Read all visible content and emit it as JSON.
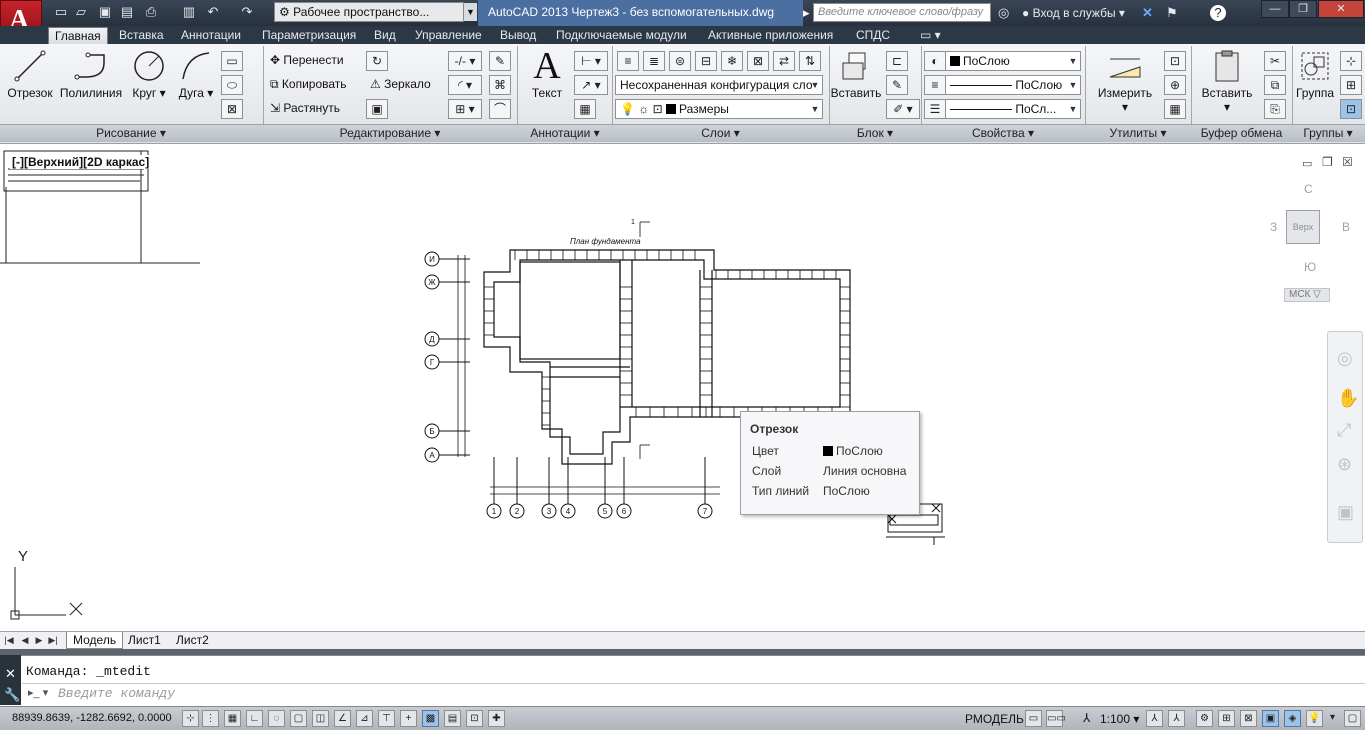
{
  "titlebar": {
    "workspace": "Рабочее пространство...",
    "app_title": "AutoCAD 2013   Чертеж3 - без вспомогательных.dwg",
    "search_placeholder": "Введите ключевое слово/фразу",
    "login": "Вход в службы"
  },
  "tabs": [
    "Главная",
    "Вставка",
    "Аннотации",
    "Параметризация",
    "Вид",
    "Управление",
    "Вывод",
    "Подключаемые модули",
    "Активные приложения",
    "СПДС"
  ],
  "ribbon": {
    "draw": {
      "line": "Отрезок",
      "polyline": "Полилиния",
      "circle": "Круг",
      "arc": "Дуга",
      "title": "Рисование"
    },
    "modify": {
      "move": "Перенести",
      "copy": "Копировать",
      "stretch": "Растянуть",
      "mirror": "Зеркало",
      "title": "Редактирование"
    },
    "annotation": {
      "text": "Текст",
      "title": "Аннотации"
    },
    "layers": {
      "layer_state": "Несохраненная конфигурация сло",
      "current_layer": "Размеры",
      "title": "Слои"
    },
    "block": {
      "insert": "Вставить",
      "title": "Блок"
    },
    "properties": {
      "color": "ПоСлою",
      "lineweight": "ПоСлою",
      "linetype": "ПоСл...",
      "title": "Свойства"
    },
    "utilities": {
      "measure": "Измерить",
      "title": "Утилиты"
    },
    "clipboard": {
      "paste": "Вставить",
      "title": "Буфер обмена"
    },
    "groups": {
      "group": "Группа",
      "title": "Группы"
    }
  },
  "viewport": {
    "label": "[-][Верхний][2D каркас]",
    "viewcube": {
      "north": "С",
      "south": "Ю",
      "west": "З",
      "east": "В",
      "face": "Верх",
      "ucs": "МСК"
    }
  },
  "drawing": {
    "axis_labels_left": [
      "И",
      "Ж",
      "Д",
      "Г",
      "Б",
      "А"
    ],
    "axis_labels_bottom": [
      "1",
      "2",
      "3",
      "4",
      "5",
      "6",
      "7"
    ],
    "plan_title": "План фундамента",
    "section_mark": "1"
  },
  "tooltip": {
    "title": "Отрезок",
    "rows": [
      {
        "key": "Цвет",
        "value": "ПоСлою"
      },
      {
        "key": "Слой",
        "value": "Линия основна"
      },
      {
        "key": "Тип линий",
        "value": "ПоСлою"
      }
    ]
  },
  "ucs_icon": {
    "x": "X",
    "y": "Y"
  },
  "layout_tabs": [
    "Модель",
    "Лист1",
    "Лист2"
  ],
  "command": {
    "history": "Команда:  _mtedit",
    "placeholder": "Введите команду"
  },
  "status": {
    "coords": "88939.8639, -1282.6692, 0.0000",
    "space": "РМОДЕЛЬ",
    "scale": "1:100"
  },
  "colors": {
    "titlebar": "#2f3a48",
    "app_title_bg": "#4a6fa0",
    "ribbon": "#e9ebee",
    "logo": "#c8232a"
  }
}
